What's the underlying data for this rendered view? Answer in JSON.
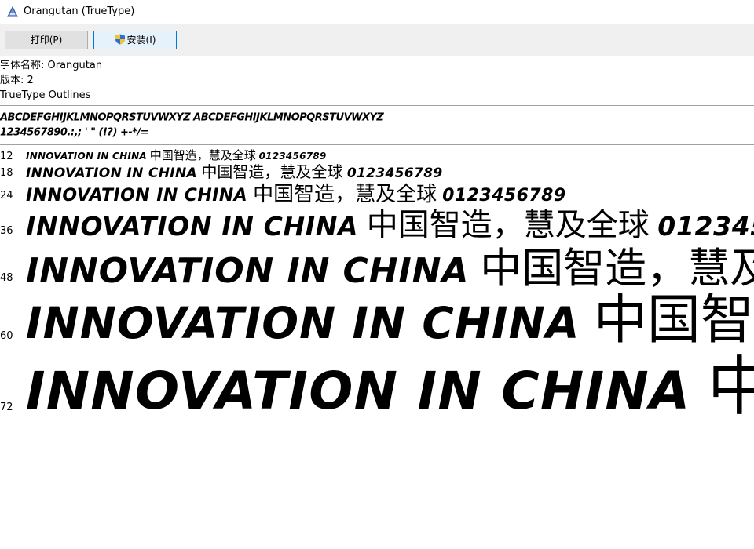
{
  "window": {
    "title": "Orangutan (TrueType)",
    "app_icon": "font-viewer-icon"
  },
  "toolbar": {
    "print_label": "打印(P)",
    "install_label": "安装(I)",
    "install_icon": "uac-shield-icon"
  },
  "font_info": {
    "name_line": "字体名称: Orangutan",
    "version_line": "版本: 2",
    "type_line": "TrueType Outlines"
  },
  "charset": {
    "line1": "ABCDEFGHIJKLMNOPQRSTUVWXYZ ABCDEFGHIJKLMNOPQRSTUVWXYZ",
    "line2": "1234567890.:,; ' \" (!?) +-*/="
  },
  "samples": {
    "latin": "INNOVATION IN CHINA",
    "cjk": "中国智造，慧及全球",
    "digits": "0123456789",
    "rows": [
      {
        "size": "12"
      },
      {
        "size": "18"
      },
      {
        "size": "24"
      },
      {
        "size": "36"
      },
      {
        "size": "48"
      },
      {
        "size": "60"
      },
      {
        "size": "72"
      }
    ]
  }
}
